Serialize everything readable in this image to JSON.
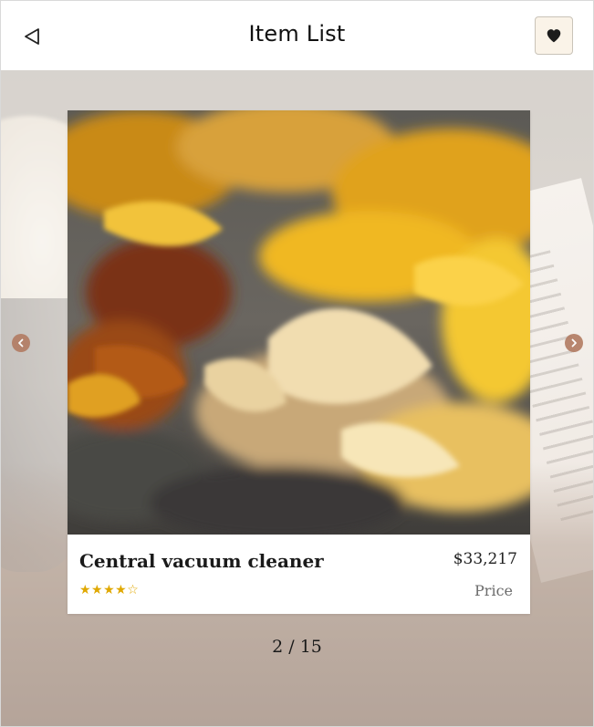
{
  "header": {
    "title": "Item List",
    "back_icon": "back-triangle-icon",
    "favorite_icon": "heart-icon"
  },
  "carousel": {
    "current_page": "2",
    "total_pages": "15",
    "page_indicator": "2 / 15",
    "prev_icon": "chevron-left-icon",
    "next_icon": "chevron-right-icon"
  },
  "item": {
    "name": "Central vacuum cleaner",
    "price": "$33,217",
    "price_label": "Price",
    "rating": 4,
    "rating_max": 5,
    "rating_display": "★★★★☆"
  },
  "colors": {
    "accent_button_bg": "#faf3e8",
    "star_color": "#e0a800",
    "arrow_color": "#b27b62"
  }
}
